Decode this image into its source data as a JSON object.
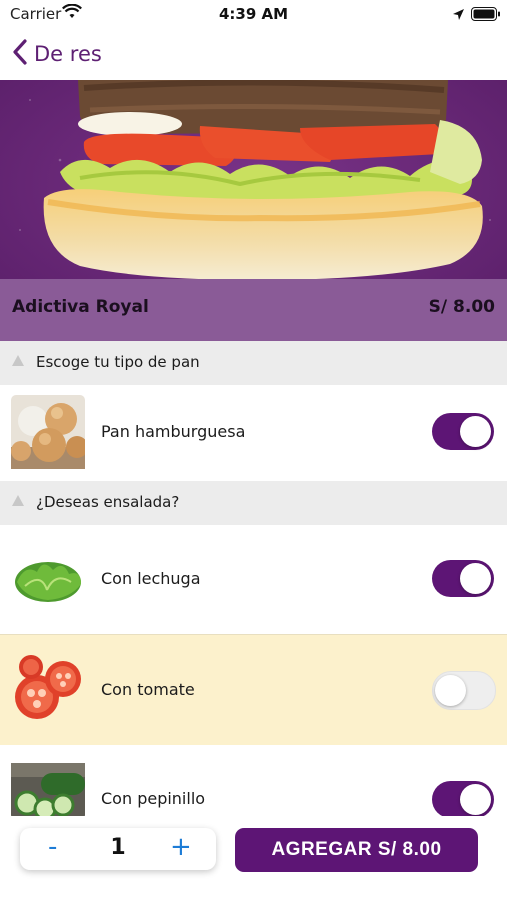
{
  "status_bar": {
    "carrier": "Carrier",
    "time": "4:39 AM",
    "icons": [
      "wifi-icon",
      "location-arrow-icon",
      "battery-icon"
    ]
  },
  "nav": {
    "back_label": "De res",
    "back_icon": "chevron-left-icon"
  },
  "product": {
    "name": "Adictiva Royal",
    "price": "S/ 8.00"
  },
  "sections": [
    {
      "title": "Escoge tu tipo de pan",
      "options": [
        {
          "label": "Pan hamburguesa",
          "selected": true,
          "image": "bread-buns"
        }
      ]
    },
    {
      "title": "¿Deseas ensalada?",
      "options": [
        {
          "label": "Con lechuga",
          "selected": true,
          "image": "lettuce"
        },
        {
          "label": "Con tomate",
          "selected": false,
          "image": "tomato-slices"
        },
        {
          "label": "Con pepinillo",
          "selected": true,
          "image": "cucumber"
        }
      ]
    }
  ],
  "footer": {
    "minus_label": "-",
    "quantity": "1",
    "plus_label": "+",
    "add_button_label": "AGREGAR S/ 8.00"
  },
  "colors": {
    "brand_purple": "#5d1575",
    "accent_blue": "#1d7cd6",
    "highlight_row": "#fcf1cc",
    "section_header": "#ececec"
  }
}
